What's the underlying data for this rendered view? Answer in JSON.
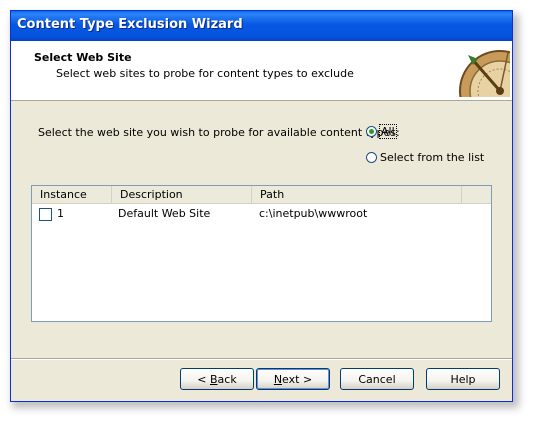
{
  "window": {
    "title": "Content Type Exclusion Wizard"
  },
  "header": {
    "title": "Select Web Site",
    "subtitle": "Select web sites to probe for content types to exclude"
  },
  "prompt": "Select the web site you wish to probe for available content types:",
  "radios": [
    {
      "label": "All",
      "checked": true
    },
    {
      "label": "Select from the list",
      "checked": false
    }
  ],
  "table": {
    "columns": [
      "Instance",
      "Description",
      "Path"
    ],
    "rows": [
      {
        "checked": false,
        "instance": "1",
        "description": "Default Web Site",
        "path": "c:\\inetpub\\wwwroot"
      }
    ]
  },
  "buttons": {
    "back": {
      "prefix": "< ",
      "mnemonic": "B",
      "rest": "ack"
    },
    "next": {
      "mnemonic": "N",
      "rest": "ext >"
    },
    "cancel": "Cancel",
    "help": "Help"
  },
  "colors": {
    "title_bar": "#0554dd",
    "dialog_bg": "#ece9d8",
    "radio_dot": "#21a121"
  }
}
